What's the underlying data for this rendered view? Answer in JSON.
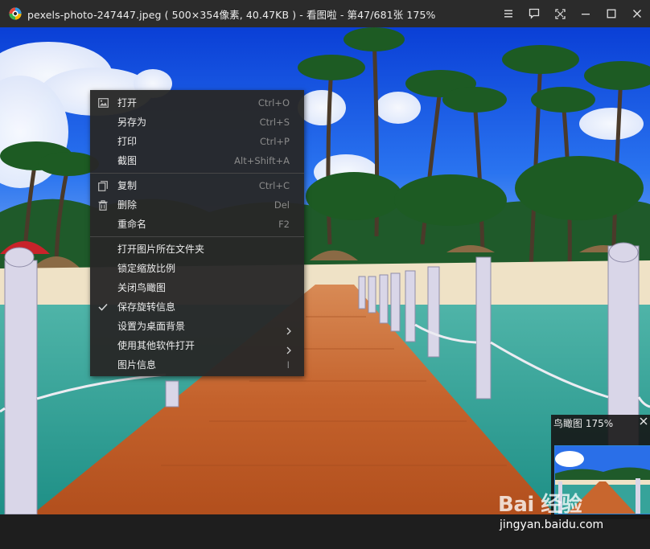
{
  "window": {
    "title": "pexels-photo-247447.jpeg ( 500×354像素, 40.47KB ) - 看图啦 - 第47/681张 175%",
    "controls": [
      "menu-icon",
      "comment-icon",
      "fullscreen-icon",
      "minimize-icon",
      "maximize-icon",
      "close-icon"
    ]
  },
  "context_menu": {
    "groups": [
      [
        {
          "label": "打开",
          "shortcut": "Ctrl+O",
          "icon": "image-icon"
        },
        {
          "label": "另存为",
          "shortcut": "Ctrl+S"
        },
        {
          "label": "打印",
          "shortcut": "Ctrl+P"
        },
        {
          "label": "截图",
          "shortcut": "Alt+Shift+A"
        }
      ],
      [
        {
          "label": "复制",
          "shortcut": "Ctrl+C",
          "icon": "copy-icon"
        },
        {
          "label": "删除",
          "shortcut": "Del",
          "icon": "trash-icon"
        },
        {
          "label": "重命名",
          "shortcut": "F2"
        }
      ],
      [
        {
          "label": "打开图片所在文件夹"
        },
        {
          "label": "锁定缩放比例"
        },
        {
          "label": "关闭鸟瞰图"
        },
        {
          "label": "保存旋转信息",
          "checked": true
        },
        {
          "label": "设置为桌面背景",
          "submenu": true
        },
        {
          "label": "使用其他软件打开",
          "submenu": true
        },
        {
          "label": "图片信息",
          "shortcut": "I"
        }
      ]
    ]
  },
  "navigator": {
    "title": "鸟瞰图  175%"
  },
  "watermark": {
    "logo": "Bai 经验",
    "url": "jingyan.baidu.com"
  },
  "colors": {
    "titlebar": "#2b2b2b",
    "menu_bg": "#282828",
    "accent": "#2b84d6"
  }
}
